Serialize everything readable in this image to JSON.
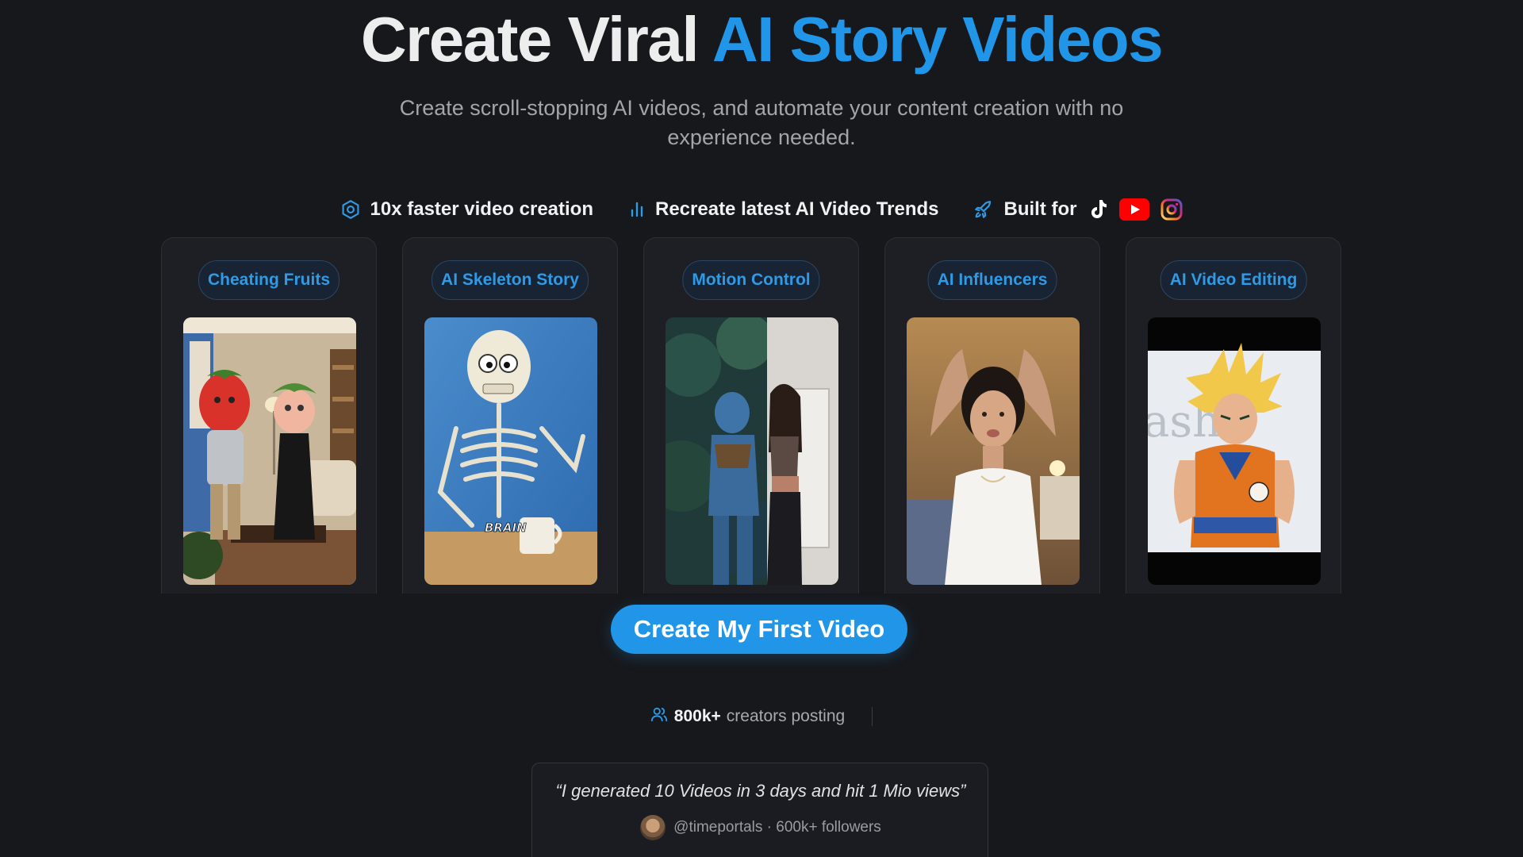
{
  "hero": {
    "title_plain": "Create Viral",
    "title_accent": "AI Story Videos",
    "subtitle": "Create scroll-stopping AI videos, and automate your content creation with no experience needed.",
    "accent_color": "#2196e8"
  },
  "features": [
    {
      "icon": "gear-hexagon-icon",
      "label": "10x faster video creation"
    },
    {
      "icon": "bar-chart-icon",
      "label": "Recreate latest AI Video Trends"
    },
    {
      "icon": "rocket-icon",
      "label": "Built for"
    }
  ],
  "platforms": [
    "tiktok-icon",
    "youtube-icon",
    "instagram-icon"
  ],
  "cards": [
    {
      "label": "Cheating Fruits",
      "image": "strawberry-headed couple in living room"
    },
    {
      "label": "AI Skeleton Story",
      "image": "skeleton with coffee mug",
      "image_text": "BRAIN"
    },
    {
      "label": "Motion Control",
      "image": "split: blue alien / woman dancing"
    },
    {
      "label": "AI Influencers",
      "image": "woman in white tank top"
    },
    {
      "label": "AI Video Editing",
      "image": "spiky blond anime fighter figure",
      "image_text": "ashi"
    }
  ],
  "cta": {
    "label": "Create My First Video"
  },
  "stats": {
    "count": "800k+",
    "label": "creators posting"
  },
  "testimonial": {
    "quote": "“I generated 10 Videos in 3 days and hit 1 Mio views”",
    "author": "@timeportals · 600k+ followers"
  }
}
